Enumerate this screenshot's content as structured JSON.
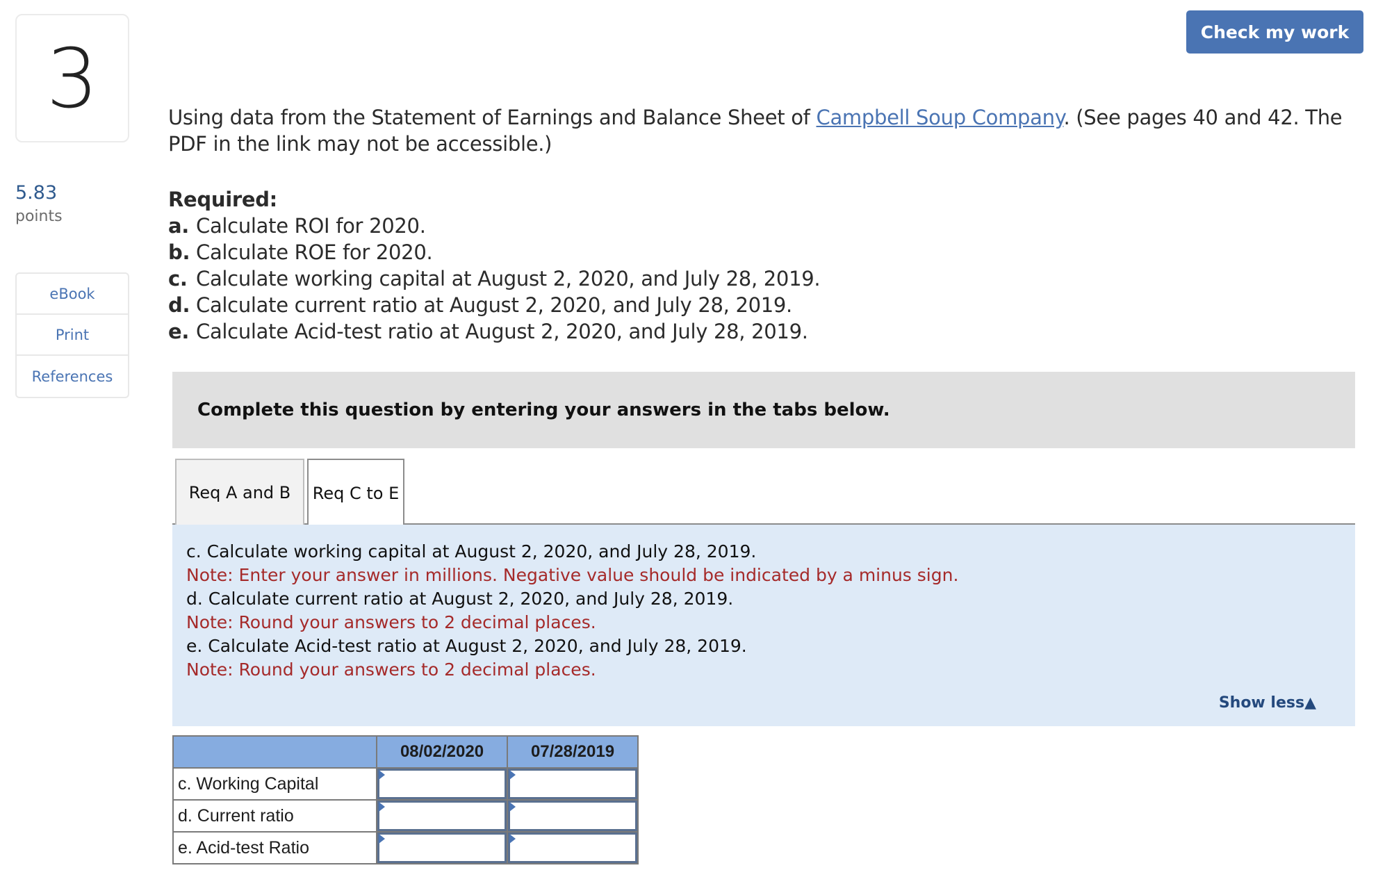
{
  "question": {
    "number": "3",
    "points_value": "5.83",
    "points_label": "points"
  },
  "sidenav": {
    "items": [
      {
        "label": "eBook"
      },
      {
        "label": "Print"
      },
      {
        "label": "References"
      }
    ]
  },
  "header": {
    "check_button_label": "Check my work"
  },
  "intro": {
    "before_link": "Using data from the Statement of Earnings and Balance Sheet of ",
    "link_text": "Campbell Soup Company",
    "after_link": ". (See pages 40 and 42. The PDF in the link may not be accessible.)"
  },
  "required": {
    "heading": "Required:",
    "items": [
      {
        "letter": "a.",
        "text": "Calculate ROI for 2020."
      },
      {
        "letter": "b.",
        "text": "Calculate ROE for 2020."
      },
      {
        "letter": "c.",
        "text": "Calculate working capital at August 2, 2020, and July 28, 2019."
      },
      {
        "letter": "d.",
        "text": "Calculate current ratio at August 2, 2020, and July 28, 2019."
      },
      {
        "letter": "e.",
        "text": "Calculate Acid-test ratio at August 2, 2020, and July 28, 2019."
      }
    ]
  },
  "instruction_box": {
    "text": "Complete this question by entering your answers in the tabs below."
  },
  "tabs": [
    {
      "label": "Req A and B",
      "active": false
    },
    {
      "label": "Req C to E",
      "active": true
    }
  ],
  "panel": {
    "lines": [
      {
        "text": "c. Calculate working capital at August 2, 2020, and July 28, 2019.",
        "type": "instruction"
      },
      {
        "text": "Note: Enter your answer in millions. Negative value should be indicated by a minus sign.",
        "type": "note"
      },
      {
        "text": "d. Calculate current ratio at August 2, 2020, and July 28, 2019.",
        "type": "instruction"
      },
      {
        "text": "Note: Round your answers to 2 decimal places.",
        "type": "note"
      },
      {
        "text": "e. Calculate Acid-test ratio at August 2, 2020, and July 28, 2019.",
        "type": "instruction"
      },
      {
        "text": "Note: Round your answers to 2 decimal places.",
        "type": "note"
      }
    ],
    "show_less_label": "Show less",
    "show_less_icon": "▲"
  },
  "answer_table": {
    "columns": [
      "",
      "08/02/2020",
      "07/28/2019"
    ],
    "rows": [
      {
        "label": "c. Working Capital",
        "values": [
          "",
          ""
        ]
      },
      {
        "label": "d. Current ratio",
        "values": [
          "",
          ""
        ]
      },
      {
        "label": "e. Acid-test Ratio",
        "values": [
          "",
          ""
        ]
      }
    ]
  },
  "colors": {
    "accent": "#4a74b3",
    "note_red": "#a52a2a",
    "panel_bg": "#deeaf7",
    "table_header_bg": "#86ace0",
    "instruction_bg": "#e0e0e0"
  }
}
